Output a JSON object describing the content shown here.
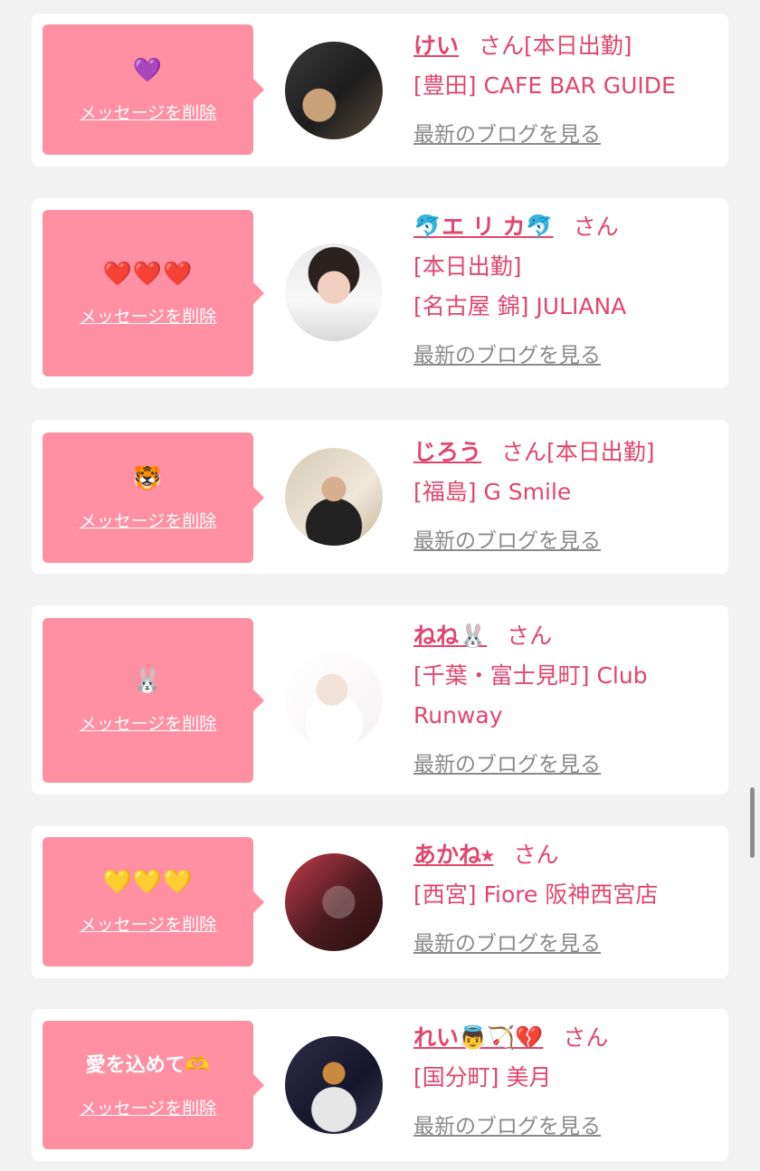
{
  "cards": [
    {
      "message": "💜",
      "message_is_emoji": true,
      "delete_label": "メッセージを削除",
      "name": "けい",
      "san": "さん",
      "status": "[本日出勤]",
      "shop": "[豊田] CAFE BAR GUIDE",
      "shop2": "",
      "blog_label": "最新のブログを見る"
    },
    {
      "message": "❤️❤️❤️",
      "message_is_emoji": true,
      "delete_label": "メッセージを削除",
      "name": "🐬エ リ カ🐬",
      "san": "さん",
      "status": "[本日出勤]",
      "shop": "[名古屋 錦] JULIANA",
      "shop2": "",
      "blog_label": "最新のブログを見る"
    },
    {
      "message": "🐯",
      "message_is_emoji": true,
      "delete_label": "メッセージを削除",
      "name": "じろう",
      "san": "さん",
      "status": "[本日出勤]",
      "shop": "[福島] G Smile",
      "shop2": "",
      "blog_label": "最新のブログを見る"
    },
    {
      "message": "🐰",
      "message_is_emoji": true,
      "delete_label": "メッセージを削除",
      "name": "ねね🐰",
      "san": "さん",
      "status": "",
      "shop": "[千葉・富士見町] Club",
      "shop2": "Runway",
      "blog_label": "最新のブログを見る"
    },
    {
      "message": "💛💛💛",
      "message_is_emoji": true,
      "delete_label": "メッセージを削除",
      "name": "あかね⭑",
      "san": "さん",
      "status": "",
      "shop": "[西宮] Fiore 阪神西宮店",
      "shop2": "",
      "blog_label": "最新のブログを見る"
    },
    {
      "message": "愛を込めて🫶",
      "message_is_emoji": false,
      "delete_label": "メッセージを削除",
      "name": "れい👼🏹💔",
      "san": "さん",
      "status": "",
      "shop": "[国分町] 美月",
      "shop2": "",
      "blog_label": "最新のブログを見る"
    }
  ]
}
